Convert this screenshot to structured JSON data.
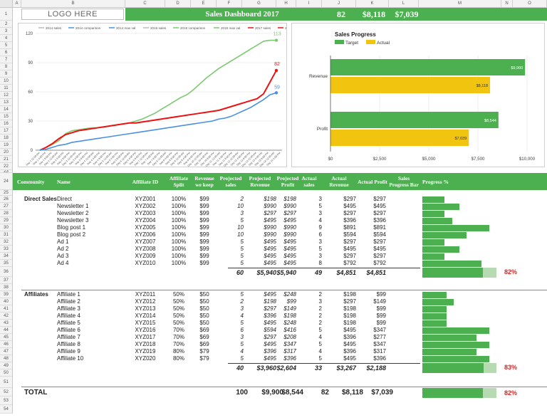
{
  "columns": [
    "A",
    "B",
    "C",
    "D",
    "E",
    "F",
    "G",
    "H",
    "I",
    "J",
    "K",
    "L",
    "M",
    "N",
    "O"
  ],
  "rows": [
    "1",
    "2",
    "3",
    "4",
    "5",
    "6",
    "7",
    "8",
    "9",
    "10",
    "11",
    "12",
    "13",
    "14",
    "15",
    "16",
    "17",
    "18",
    "19",
    "20",
    "21",
    "22",
    "23",
    "24",
    "25",
    "26",
    "27",
    "28",
    "29",
    "30",
    "31",
    "32",
    "33",
    "34",
    "35",
    "36",
    "37",
    "38",
    "39",
    "40",
    "41",
    "42",
    "43",
    "44",
    "45",
    "46",
    "47",
    "48",
    "49",
    "50",
    "51",
    "52",
    "53",
    "54"
  ],
  "header": {
    "logo": "LOGO HERE",
    "title": "Sales Dashboard 2017",
    "kpi_sales": "82",
    "kpi_revenue": "$8,118",
    "kpi_profit": "$7,039"
  },
  "colors": {
    "green": "#4cb050",
    "red": "#e02020",
    "yellow": "#f1c40f",
    "blue": "#4a90e2"
  },
  "chart_data": [
    {
      "type": "line",
      "legend": [
        "2014 sales",
        "2014 comparison",
        "2014 max val",
        "2016 sales",
        "2016 comparison",
        "2016 max val",
        "2017 sales",
        "2017 max val"
      ],
      "legend_colors": [
        "#bbbbbb",
        "#4a90e2",
        "#4a90e2",
        "#bbbbbb",
        "#7bc96f",
        "#7bc96f",
        "#ee1111",
        "#ee1111"
      ],
      "ylim": [
        0,
        120
      ],
      "yticks": [
        "0",
        "30",
        "60",
        "90",
        "120"
      ],
      "xticks": [
        "Day 1 12:00 AM",
        "Day 1 4:00 PM",
        "Day 1 8:00 PM",
        "Day 2 12:00 AM",
        "Day 2 4:00 PM",
        "Day 2 8:00 PM",
        "Day 3 12:00 AM",
        "Day 3 4:00 PM",
        "Day 3 8:00 PM",
        "Day 4 12:00 AM",
        "Day 4 4:00 PM",
        "Day 4 8:00 PM",
        "Day 5 12:00 AM",
        "Day 5 4:00 PM",
        "Day 5 8:00 PM",
        "Day 6 12:00 AM",
        "Day 6 4:00 PM",
        "Day 6 8:00 PM",
        "Day 7 12:00 AM",
        "Day 7 4:00 PM",
        "Day 7 8:00 PM",
        "Day 8 12:00 AM",
        "Day 8 4:00 PM",
        "Day 8 8:00 PM",
        "Day 9 12:00 AM",
        "Day 9 4:00 PM",
        "Day 9 8:00 PM",
        "Day 10 12:00 AM",
        "Day 10 4:00 PM",
        "Day 10 8:00 PM",
        "Day 11 12:00 AM",
        "Day 11 4:00 PM",
        "Day 11 8:00 PM",
        "Day 12 12:00 AM",
        "Day 12 4:00 PM",
        "Day 12 8:00 PM",
        "Day 13 12:00 AM",
        "Day 13 4:00 PM",
        "Day 13 8:00 PM",
        "Day 14 12:00 AM",
        "Day 14 4:00 PM"
      ],
      "series": [
        {
          "name": "2016 comparison",
          "color": "#7bc96f",
          "end_label": "113",
          "values": [
            0,
            3,
            6,
            10,
            17,
            20,
            21,
            22,
            23,
            23,
            24,
            25,
            26,
            27,
            28,
            30,
            32,
            35,
            38,
            42,
            46,
            50,
            54,
            57,
            62,
            68,
            74,
            79,
            84,
            88,
            92,
            96,
            100,
            104,
            108,
            112,
            113,
            113
          ]
        },
        {
          "name": "2017 sales",
          "color": "#ee1111",
          "end_label": "82",
          "values": [
            0,
            3,
            7,
            12,
            16,
            18,
            20,
            21,
            22,
            23,
            24,
            25,
            26,
            27,
            28,
            28,
            29,
            30,
            31,
            32,
            33,
            34,
            35,
            36,
            37,
            38,
            39,
            40,
            41,
            43,
            45,
            47,
            49,
            51,
            53,
            58,
            70,
            82
          ]
        },
        {
          "name": "2014 comparison",
          "color": "#4a90e2",
          "end_label": "59",
          "values": [
            0,
            1,
            3,
            5,
            6,
            8,
            9,
            10,
            11,
            12,
            13,
            14,
            15,
            16,
            17,
            18,
            19,
            20,
            21,
            22,
            23,
            24,
            25,
            26,
            27,
            28,
            29,
            30,
            32,
            33,
            35,
            38,
            41,
            44,
            48,
            52,
            57,
            59
          ]
        }
      ]
    },
    {
      "type": "bar",
      "title": "Sales Progress",
      "legend": [
        "Target",
        "Actual"
      ],
      "legend_colors": [
        "#4cb050",
        "#f1c40f"
      ],
      "categories": [
        "Revenue",
        "Profit"
      ],
      "series": [
        {
          "name": "Target",
          "values": [
            9900,
            8544
          ]
        },
        {
          "name": "Actual",
          "values": [
            8118,
            7039
          ]
        }
      ],
      "value_labels": [
        [
          "$9,900",
          "$8,118"
        ],
        [
          "$8,544",
          "$7,039"
        ]
      ],
      "xlim": [
        0,
        10000
      ],
      "xticks": [
        "$0",
        "$2,500",
        "$5,000",
        "$7,500",
        "$10,000"
      ]
    }
  ],
  "table_header": [
    "Community",
    "Name",
    "Affiliate ID",
    "Affiliate Split",
    "Revenue we keep",
    "Projected sales",
    "Projected Revenue",
    "Projected Profit",
    "Actual sales",
    "Actual Revenue",
    "Actual Profit",
    "Sales Progress Bar",
    "Progress %"
  ],
  "direct_label": "Direct Sales",
  "direct": [
    [
      "Direct",
      "XYZ001",
      "100%",
      "$99",
      "2",
      "$198",
      "$198",
      "3",
      "$297",
      "$297",
      0.3
    ],
    [
      "Newsletter 1",
      "XYZ002",
      "100%",
      "$99",
      "10",
      "$990",
      "$990",
      "5",
      "$495",
      "$495",
      0.5
    ],
    [
      "Newsletter 2",
      "XYZ003",
      "100%",
      "$99",
      "3",
      "$297",
      "$297",
      "3",
      "$297",
      "$297",
      0.3
    ],
    [
      "Newsletter 3",
      "XYZ004",
      "100%",
      "$99",
      "5",
      "$495",
      "$495",
      "4",
      "$396",
      "$396",
      0.4
    ],
    [
      "Blog post 1",
      "XYZ005",
      "100%",
      "$99",
      "10",
      "$990",
      "$990",
      "9",
      "$891",
      "$891",
      0.9
    ],
    [
      "Blog post 2",
      "XYZ006",
      "100%",
      "$99",
      "10",
      "$990",
      "$990",
      "6",
      "$594",
      "$594",
      0.6
    ],
    [
      "Ad 1",
      "XYZ007",
      "100%",
      "$99",
      "5",
      "$495",
      "$495",
      "3",
      "$297",
      "$297",
      0.3
    ],
    [
      "Ad 2",
      "XYZ008",
      "100%",
      "$99",
      "5",
      "$495",
      "$495",
      "5",
      "$495",
      "$495",
      0.5
    ],
    [
      "Ad 3",
      "XYZ009",
      "100%",
      "$99",
      "5",
      "$495",
      "$495",
      "3",
      "$297",
      "$297",
      0.3
    ],
    [
      "Ad 4",
      "XYZ010",
      "100%",
      "$99",
      "5",
      "$495",
      "$495",
      "8",
      "$792",
      "$792",
      0.8
    ]
  ],
  "direct_total": [
    "60",
    "$5,940",
    "$5,940",
    "49",
    "$4,851",
    "$4,851",
    "82%"
  ],
  "direct_total_progress": 0.82,
  "affiliates_label": "Affiliates",
  "affiliates": [
    [
      "Affiliate 1",
      "XYZ011",
      "50%",
      "$50",
      "5",
      "$495",
      "$248",
      "2",
      "$198",
      "$99",
      0.33
    ],
    [
      "Affiliate 2",
      "XYZ012",
      "50%",
      "$50",
      "2",
      "$198",
      "$99",
      "3",
      "$297",
      "$149",
      0.42
    ],
    [
      "Affiliate 3",
      "XYZ013",
      "50%",
      "$50",
      "3",
      "$297",
      "$149",
      "2",
      "$198",
      "$99",
      0.33
    ],
    [
      "Affiliate 4",
      "XYZ014",
      "50%",
      "$50",
      "4",
      "$396",
      "$198",
      "2",
      "$198",
      "$99",
      0.33
    ],
    [
      "Affiliate 5",
      "XYZ015",
      "50%",
      "$50",
      "5",
      "$495",
      "$248",
      "2",
      "$198",
      "$99",
      0.33
    ],
    [
      "Affiliate 6",
      "XYZ016",
      "70%",
      "$69",
      "6",
      "$594",
      "$416",
      "5",
      "$495",
      "$347",
      0.9
    ],
    [
      "Affiliate 7",
      "XYZ017",
      "70%",
      "$69",
      "3",
      "$297",
      "$208",
      "4",
      "$396",
      "$277",
      0.73
    ],
    [
      "Affiliate 8",
      "XYZ018",
      "70%",
      "$69",
      "5",
      "$495",
      "$347",
      "5",
      "$495",
      "$347",
      0.9
    ],
    [
      "Affiliate 9",
      "XYZ019",
      "80%",
      "$79",
      "4",
      "$396",
      "$317",
      "4",
      "$396",
      "$317",
      0.73
    ],
    [
      "Affiliate 10",
      "XYZ020",
      "80%",
      "$79",
      "5",
      "$495",
      "$396",
      "5",
      "$495",
      "$396",
      0.9
    ]
  ],
  "affiliates_total": [
    "40",
    "$3,960",
    "$2,604",
    "33",
    "$3,267",
    "$2,188",
    "83%"
  ],
  "affiliates_total_progress": 0.83,
  "grand_label": "TOTAL",
  "grand_total": [
    "100",
    "$9,900",
    "$8,544",
    "82",
    "$8,118",
    "$7,039",
    "82%"
  ],
  "grand_total_progress": 0.82
}
